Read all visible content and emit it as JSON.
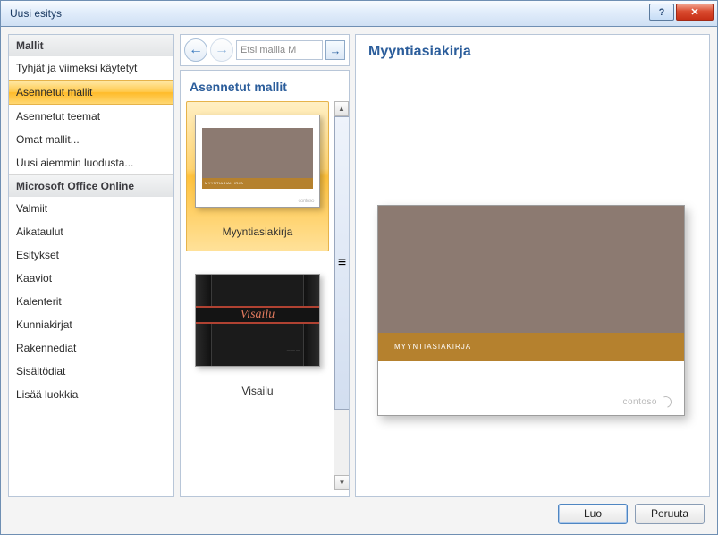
{
  "window": {
    "title": "Uusi esitys"
  },
  "sidebar": {
    "section1_heading": "Mallit",
    "section1_items": [
      "Tyhjät ja viimeksi käytetyt",
      "Asennetut mallit",
      "Asennetut teemat",
      "Omat mallit...",
      "Uusi aiemmin luodusta..."
    ],
    "section1_selected_index": 1,
    "section2_heading": "Microsoft Office Online",
    "section2_items": [
      "Valmiit",
      "Aikataulut",
      "Esitykset",
      "Kaaviot",
      "Kalenterit",
      "Kunniakirjat",
      "Rakennediat",
      "Sisältödiat",
      "Lisää luokkia"
    ]
  },
  "search": {
    "placeholder": "Etsi mallia M"
  },
  "templates": {
    "heading": "Asennetut mallit",
    "items": [
      {
        "label": "Myyntiasiakirja",
        "kind": "sales-document",
        "selected": true,
        "bandText": "MYYNTIASIAK IRJA",
        "mark": "contoso"
      },
      {
        "label": "Visailu",
        "kind": "quiz",
        "selected": false,
        "title": "Visailu"
      }
    ]
  },
  "preview": {
    "title": "Myyntiasiakirja",
    "bandText": "MYYNTIASIAKIRJA",
    "mark": "contoso"
  },
  "buttons": {
    "create": "Luo",
    "cancel": "Peruuta"
  },
  "icons": {
    "back": "←",
    "forward": "→",
    "go": "→",
    "up": "▲",
    "down": "▼",
    "grip": "≡"
  }
}
